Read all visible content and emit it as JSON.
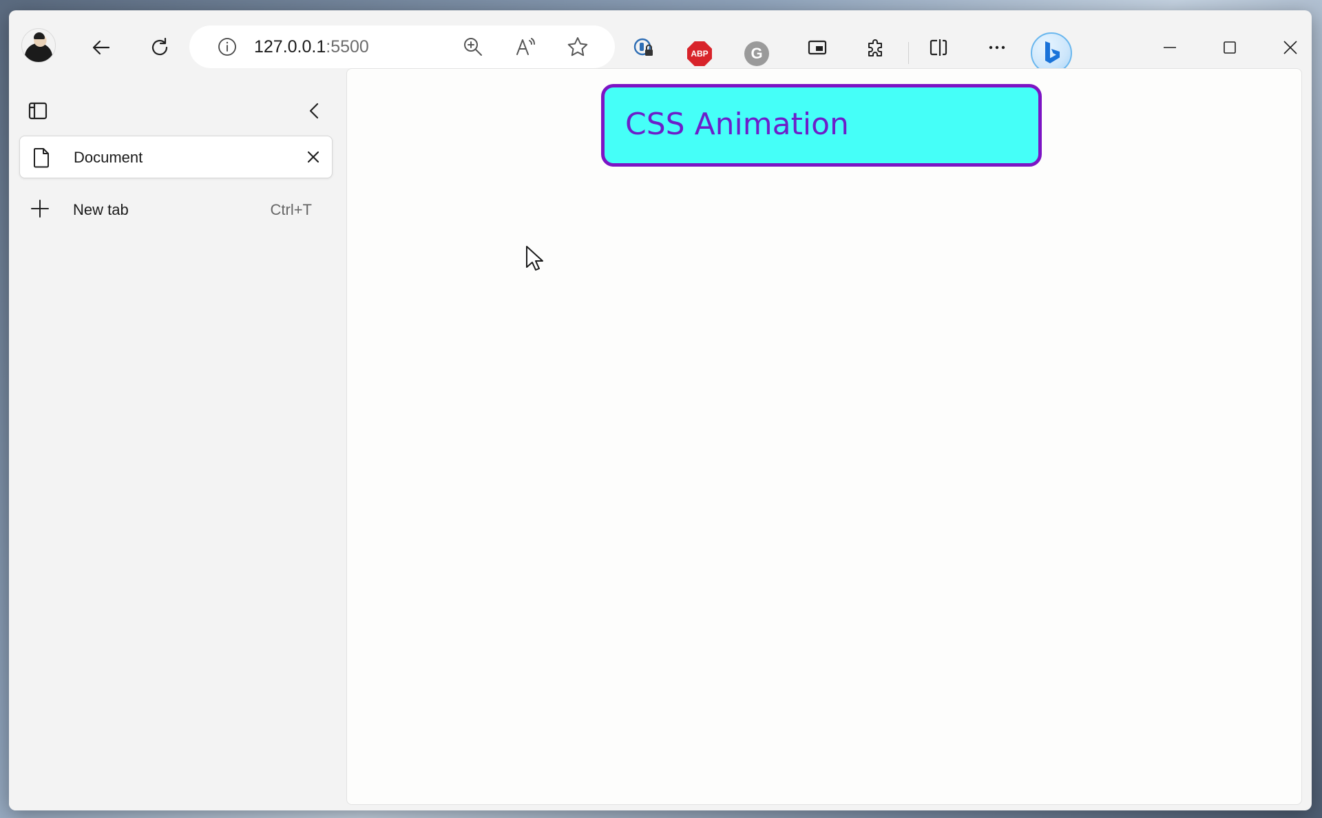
{
  "browser": {
    "address_bar": {
      "host": "127.0.0.1",
      "port": ":5500"
    },
    "extensions": {
      "abp_label": "ABP",
      "grammarly_label": "G"
    },
    "more_label": "···"
  },
  "sidebar": {
    "tabs": [
      {
        "label": "Document"
      }
    ],
    "new_tab": {
      "label": "New tab",
      "shortcut": "Ctrl+T"
    }
  },
  "page": {
    "animated_box_text": "CSS Animation",
    "colors": {
      "box_background": "#45fff8",
      "box_border": "#7c14c4",
      "box_text": "#6c1fc9"
    }
  }
}
